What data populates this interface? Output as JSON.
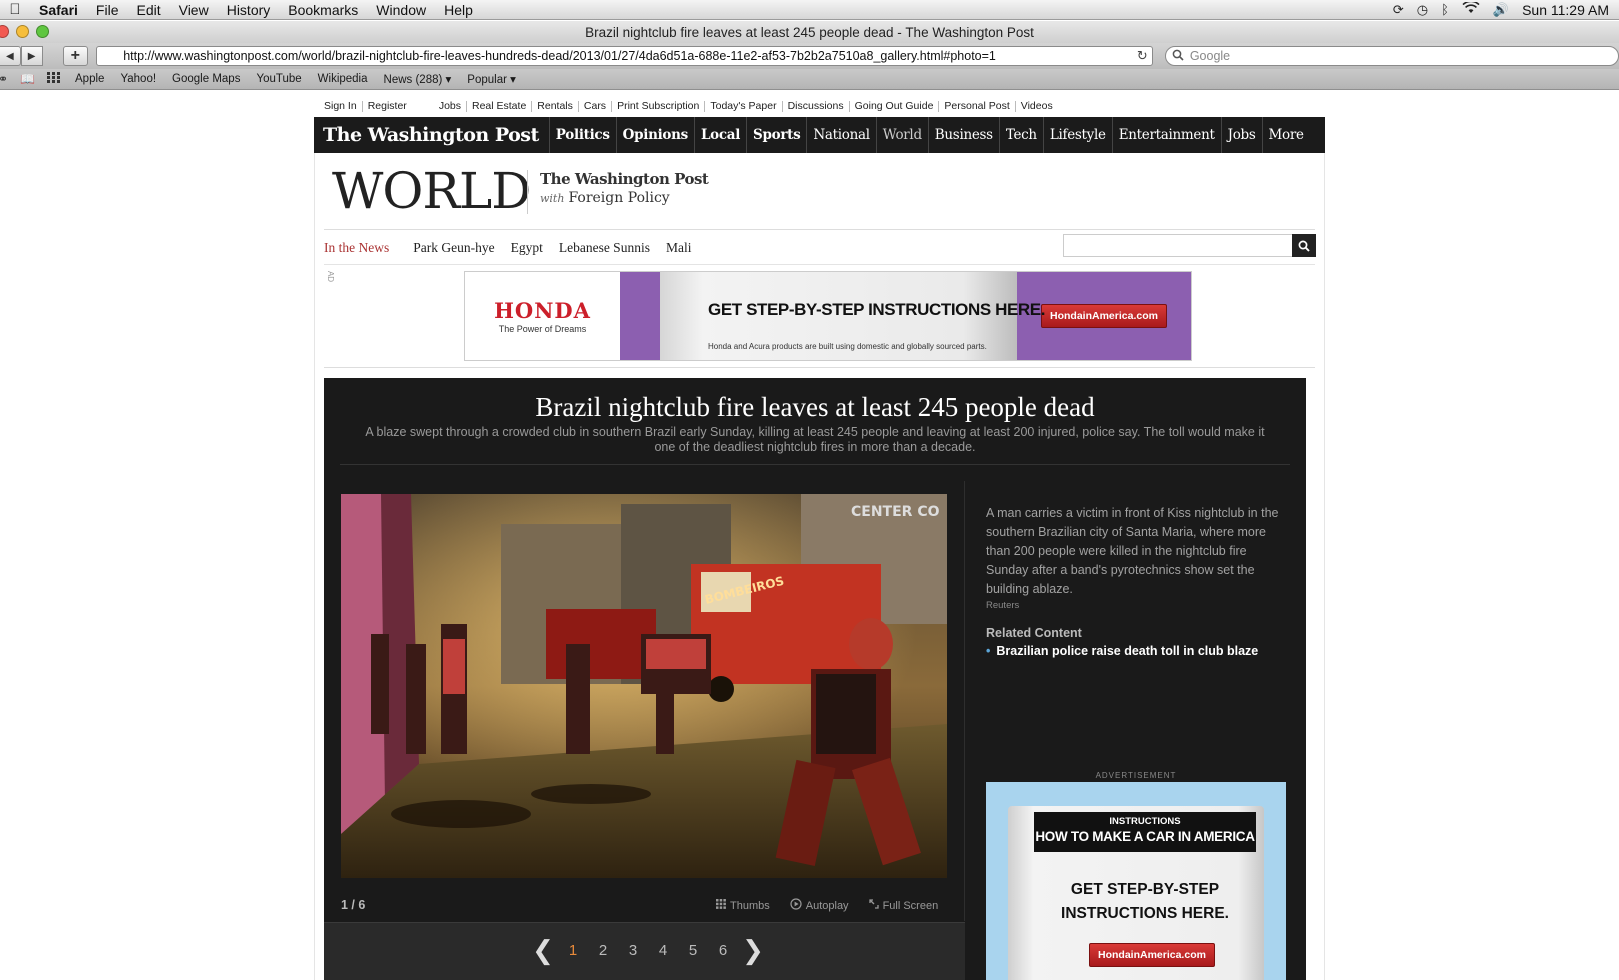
{
  "menubar": {
    "apple_icon": "apple-icon",
    "items": [
      "Safari",
      "File",
      "Edit",
      "View",
      "History",
      "Bookmarks",
      "Window",
      "Help"
    ],
    "clock": "Sun 11:29 AM"
  },
  "window": {
    "title": "Brazil nightclub fire leaves at least 245 people dead - The Washington Post"
  },
  "toolbar": {
    "back_icon": "back-arrow-icon",
    "forward_icon": "forward-arrow-icon",
    "add_label": "+",
    "url": "http://www.washingtonpost.com/world/brazil-nightclub-fire-leaves-hundreds-dead/2013/01/27/4da6d51a-688e-11e2-af53-7b2b2a7510a8_gallery.html#photo=1",
    "search_placeholder": "Google"
  },
  "bookmarks": {
    "items": [
      "Apple",
      "Yahoo!",
      "Google Maps",
      "YouTube",
      "Wikipedia",
      "News (288) ▾",
      "Popular ▾"
    ]
  },
  "utility": {
    "account": [
      "Sign In",
      "Register"
    ],
    "links": [
      "Jobs",
      "Real Estate",
      "Rentals",
      "Cars",
      "Print Subscription",
      "Today's Paper",
      "Discussions",
      "Going Out Guide",
      "Personal Post",
      "Videos"
    ]
  },
  "wpnav": {
    "logo": "The Washington Post",
    "items": [
      "Politics",
      "Opinions",
      "Local",
      "Sports",
      "National",
      "World",
      "Business",
      "Tech",
      "Lifestyle",
      "Entertainment",
      "Jobs",
      "More"
    ]
  },
  "section": {
    "title": "WORLD",
    "partner_line1": "The Washington Post",
    "partner_with": "with",
    "partner_line2": "Foreign Policy"
  },
  "in_the_news": {
    "label": "In the News",
    "topics": [
      "Park Geun-hye",
      "Egypt",
      "Lebanese Sunnis",
      "Mali"
    ]
  },
  "banner_ad": {
    "tag": "AD",
    "brand": "HONDA",
    "tagline": "The Power of Dreams",
    "headline": "GET STEP-BY-STEP INSTRUCTIONS HERE.",
    "fine_print": "Honda and Acura products are built using domestic and globally sourced parts.",
    "cta": "HondainAmerica.com"
  },
  "gallery": {
    "title": "Brazil nightclub fire leaves at least 245 people dead",
    "deck": "A blaze swept through a crowded club in southern Brazil early Sunday, killing at least 245 people and leaving at least 200 injured, police say. The toll would make it one of the deadliest nightclub fires in more than a decade.",
    "counter": "1 / 6",
    "tools": {
      "thumbs": "Thumbs",
      "autoplay": "Autoplay",
      "fullscreen": "Full Screen"
    },
    "pages": [
      "1",
      "2",
      "3",
      "4",
      "5",
      "6"
    ],
    "active_page": "1",
    "photo_signs": {
      "bombeiros": "BOMBEIROS",
      "center": "CENTER CO"
    },
    "caption": "A man carries a victim in front of Kiss nightclub in the southern Brazilian city of Santa Maria, where more than 200 people were killed in the nightclub fire Sunday after a band's pyrotechnics show set the building ablaze.",
    "credit": "Reuters",
    "related_heading": "Related Content",
    "related_link": "Brazilian police raise death toll in club blaze"
  },
  "side_ad": {
    "label": "ADVERTISEMENT",
    "kicker": "INSTRUCTIONS",
    "headline": "HOW TO MAKE A CAR IN AMERICA",
    "body": "GET STEP-BY-STEP INSTRUCTIONS HERE.",
    "cta": "HondainAmerica.com"
  }
}
